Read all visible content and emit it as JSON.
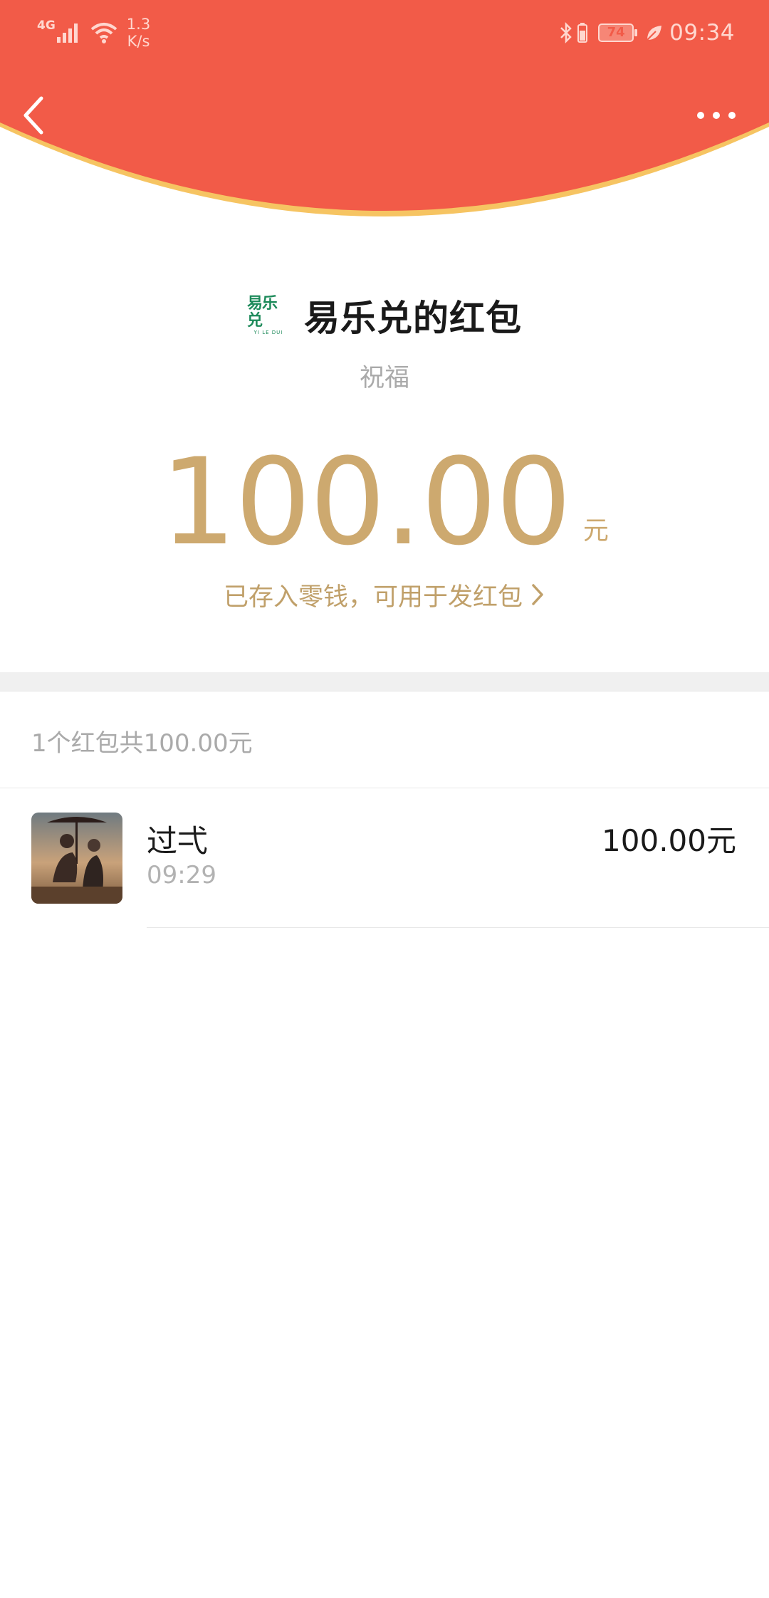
{
  "status_bar": {
    "network": "4G",
    "speed_value": "1.3",
    "speed_unit": "K/s",
    "battery": "74",
    "time": "09:34"
  },
  "header": {
    "back_icon": "back-arrow-icon",
    "more_icon": "more-dots-icon",
    "color": "#f25b48",
    "edge_color": "#f6c462"
  },
  "envelope": {
    "logo_text": "易乐兑",
    "logo_subtext": "YI LE DUI",
    "title": "易乐兑的红包",
    "blessing": "祝福",
    "amount": "100.00",
    "unit": "元",
    "deposit_text": "已存入零钱，可用于发红包",
    "gold_color": "#cda96f"
  },
  "list": {
    "summary": "1个红包共100.00元",
    "items": [
      {
        "name": "过弌",
        "time": "09:29",
        "amount": "100.00元"
      }
    ]
  }
}
